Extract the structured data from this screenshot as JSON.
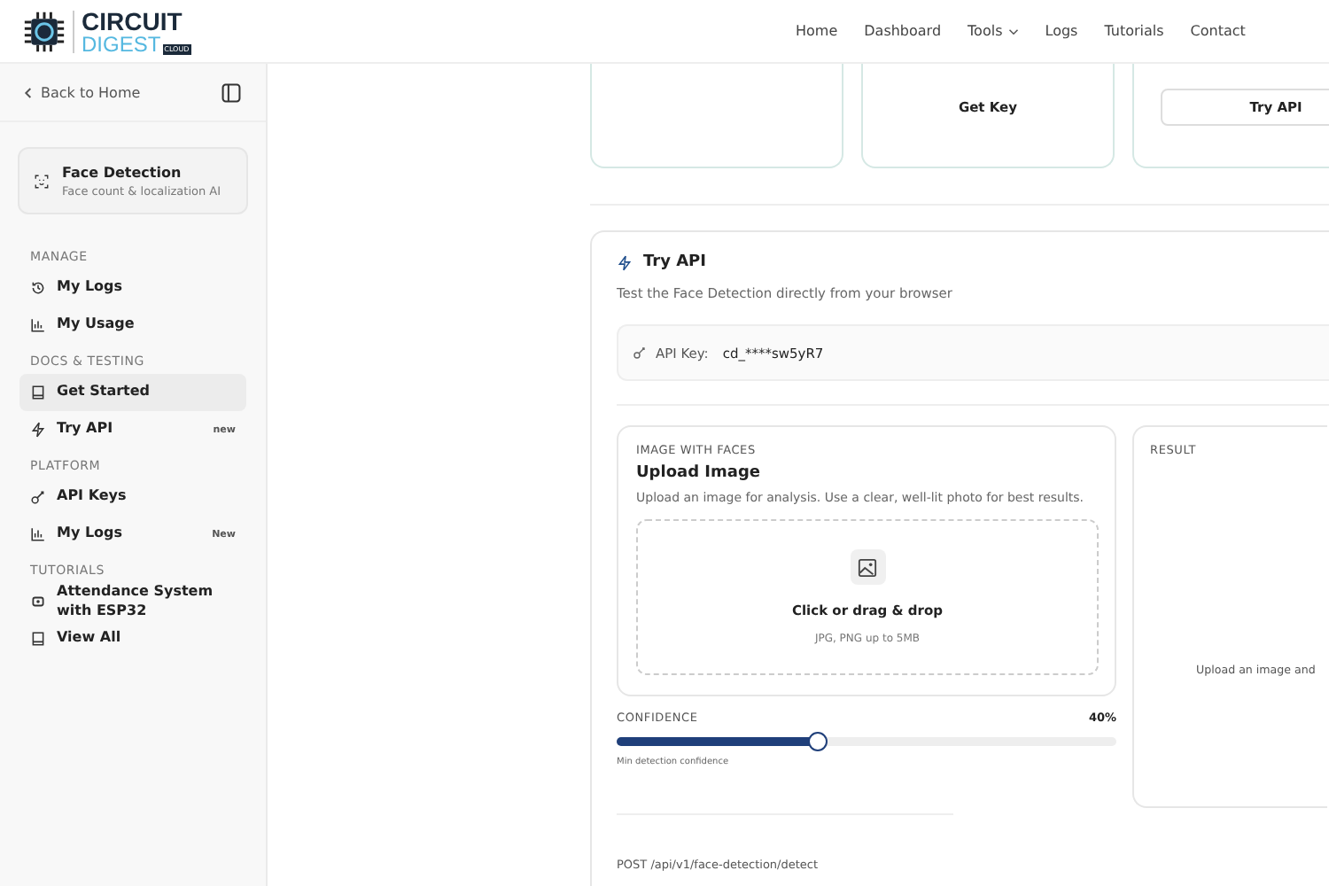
{
  "header": {
    "logo": {
      "line1": "CIRCUIT",
      "line2": "DIGEST",
      "tag": "CLOUD"
    },
    "nav": [
      {
        "label": "Home",
        "dropdown": false
      },
      {
        "label": "Dashboard",
        "dropdown": false
      },
      {
        "label": "Tools",
        "dropdown": true
      },
      {
        "label": "Logs",
        "dropdown": false
      },
      {
        "label": "Tutorials",
        "dropdown": false
      },
      {
        "label": "Contact",
        "dropdown": false
      }
    ]
  },
  "sidebar": {
    "back": "Back to Home",
    "tool": {
      "title": "Face Detection",
      "subtitle": "Face count & localization AI"
    },
    "sections": [
      {
        "title": "MANAGE",
        "items": [
          {
            "label": "My Logs",
            "selected": false
          },
          {
            "label": "My Usage",
            "selected": false
          }
        ]
      },
      {
        "title": "DOCS & TESTING",
        "items": [
          {
            "label": "Get Started",
            "selected": true
          },
          {
            "label": "Try API",
            "selected": false,
            "badge": "new"
          }
        ]
      },
      {
        "title": "PLATFORM",
        "items": [
          {
            "label": "API Keys",
            "selected": false
          },
          {
            "label": "My Logs",
            "selected": false,
            "badge": "New"
          }
        ]
      },
      {
        "title": "TUTORIALS",
        "items": [
          {
            "label": "Attendance System with ESP32",
            "selected": false
          },
          {
            "label": "View All",
            "selected": false
          }
        ]
      }
    ]
  },
  "cards": [
    {
      "kind": "plain"
    },
    {
      "kind": "filled",
      "button": "Get Key"
    },
    {
      "kind": "outlined",
      "button": "Try API"
    }
  ],
  "try_api": {
    "title": "Try API",
    "subtitle": "Test the Face Detection directly from your browser",
    "api_key_label": "API Key:",
    "api_key": "cd_****sw5yR7",
    "upload": {
      "eyebrow": "IMAGE WITH FACES",
      "title": "Upload Image",
      "description": "Upload an image for analysis. Use a clear, well-lit photo for best results.",
      "drop_title": "Click or drag & drop",
      "drop_hint": "JPG, PNG up to 5MB"
    },
    "confidence": {
      "label": "CONFIDENCE",
      "value": "40%",
      "level": 0.4,
      "caption": "Min detection confidence"
    },
    "result": {
      "title": "RESULT",
      "message": "Upload an image and"
    },
    "endpoint": "POST /api/v1/face-detection/detect"
  }
}
